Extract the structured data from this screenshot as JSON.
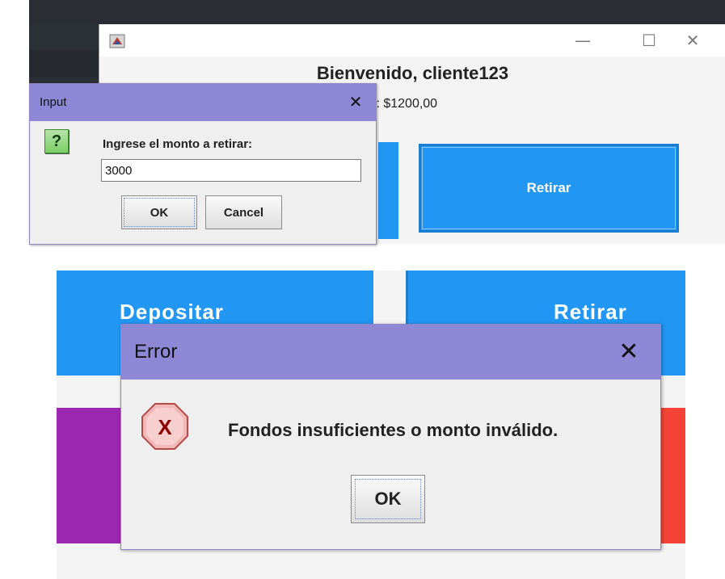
{
  "top": {
    "main_window": {
      "welcome": "Bienvenido, cliente123",
      "saldo_partial": "lo: $1200,00",
      "retirar_label": "Retirar",
      "controls": {
        "minimize": "—",
        "maximize": "☐",
        "close": "✕"
      }
    },
    "input_dialog": {
      "title": "Input",
      "close": "✕",
      "icon_glyph": "?",
      "prompt": "Ingrese el monto a retirar:",
      "value": "3000",
      "ok_label": "OK",
      "cancel_label": "Cancel"
    }
  },
  "bottom": {
    "depositar_label": "Depositar",
    "retirar_label": "Retirar",
    "error_dialog": {
      "title": "Error",
      "close": "✕",
      "icon_glyph": "X",
      "message": "Fondos insuficientes o monto inválido.",
      "ok_label": "OK"
    }
  },
  "colors": {
    "accent_blue": "#2196f3",
    "purple": "#9c27b0",
    "red": "#f44336",
    "dialog_titlebar": "#8e87d6"
  }
}
